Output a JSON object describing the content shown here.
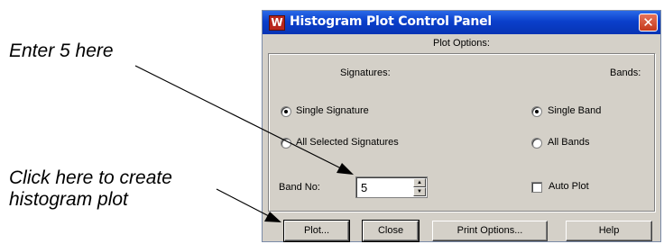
{
  "annotations": {
    "enter_value": "Enter 5 here",
    "click_plot_line1": "Click here to create",
    "click_plot_line2": "histogram plot"
  },
  "window": {
    "title": "Histogram Plot Control Panel",
    "close_glyph": "✕",
    "app_icon_glyph": "W"
  },
  "plot_options": {
    "heading": "Plot Options:",
    "signatures": {
      "heading": "Signatures:",
      "options": [
        {
          "label": "Single Signature",
          "selected": true
        },
        {
          "label": "All Selected Signatures",
          "selected": false
        }
      ]
    },
    "bands": {
      "heading": "Bands:",
      "options": [
        {
          "label": "Single Band",
          "selected": true
        },
        {
          "label": "All Bands",
          "selected": false
        }
      ]
    },
    "band_no": {
      "label": "Band No:",
      "value": "5"
    },
    "auto_plot": {
      "label": "Auto Plot",
      "checked": false
    }
  },
  "buttons": {
    "plot": "Plot...",
    "close": "Close",
    "print_options": "Print Options...",
    "help": "Help"
  },
  "icons": {
    "spin_up": "▲",
    "spin_down": "▼"
  },
  "colors": {
    "titlebar": "#0a3fcb",
    "dialog_bg": "#d4d0c8",
    "close_button": "#c4391c"
  }
}
